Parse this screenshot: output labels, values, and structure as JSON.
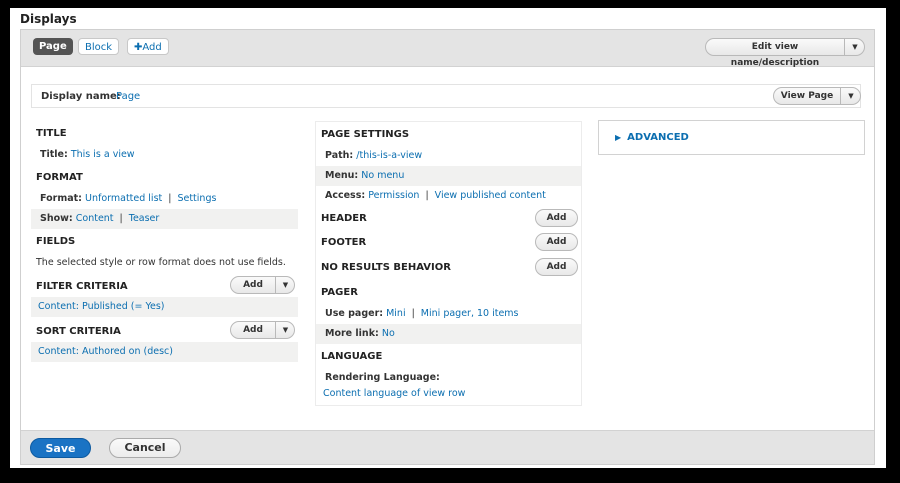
{
  "page_title": "Displays",
  "tabs": [
    {
      "label": "Page",
      "active": true
    },
    {
      "label": "Block",
      "active": false
    },
    {
      "label": "✚Add",
      "active": false
    }
  ],
  "edit_view_button": "Edit view name/description",
  "display_name": {
    "label": "Display name:",
    "value": "Page"
  },
  "view_page_button": "View Page",
  "left_column": {
    "title": {
      "heading": "TITLE",
      "label": "Title:",
      "value": "This is a view"
    },
    "format": {
      "heading": "FORMAT",
      "format_label": "Format:",
      "format_value": "Unformatted list",
      "format_settings": "Settings",
      "show_label": "Show:",
      "show_value": "Content",
      "show_mode": "Teaser"
    },
    "fields": {
      "heading": "FIELDS",
      "note": "The selected style or row format does not use fields."
    },
    "filter": {
      "heading": "FILTER CRITERIA",
      "add": "Add",
      "item": "Content: Published (= Yes)"
    },
    "sort": {
      "heading": "SORT CRITERIA",
      "add": "Add",
      "item": "Content: Authored on (desc)"
    }
  },
  "middle_column": {
    "page_settings": {
      "heading": "PAGE SETTINGS",
      "path_label": "Path:",
      "path_value": "/this-is-a-view",
      "menu_label": "Menu:",
      "menu_value": "No menu",
      "access_label": "Access:",
      "access_value": "Permission",
      "access_detail": "View published content"
    },
    "header": {
      "heading": "HEADER",
      "add": "Add"
    },
    "footer": {
      "heading": "FOOTER",
      "add": "Add"
    },
    "no_results": {
      "heading": "NO RESULTS BEHAVIOR",
      "add": "Add"
    },
    "pager": {
      "heading": "PAGER",
      "use_pager_label": "Use pager:",
      "use_pager_value": "Mini",
      "use_pager_detail": "Mini pager, 10 items",
      "more_link_label": "More link:",
      "more_link_value": "No"
    },
    "language": {
      "heading": "LANGUAGE",
      "rendering_label": "Rendering Language:",
      "rendering_value": "Content language of view row"
    }
  },
  "advanced": {
    "label": "ADVANCED",
    "icon": "triangle-right-icon"
  },
  "footer_buttons": {
    "save": "Save",
    "cancel": "Cancel"
  },
  "colors": {
    "link": "#0b6eb0",
    "primary": "#1a73c4",
    "active_tab": "#545454",
    "bar": "#e4e4e4"
  }
}
